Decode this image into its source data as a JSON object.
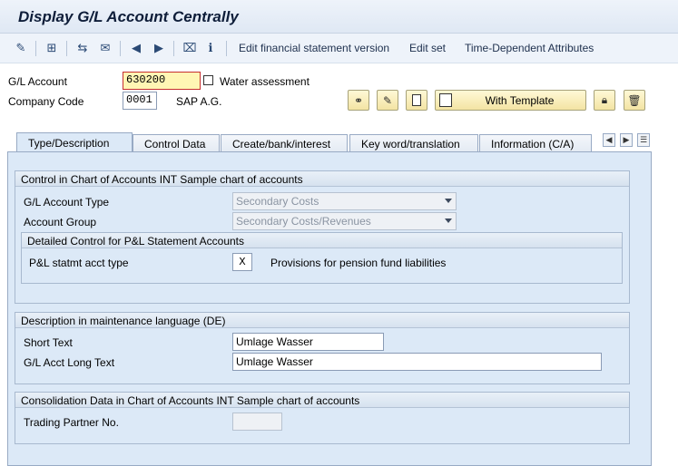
{
  "window": {
    "title": "Display G/L Account Centrally"
  },
  "toolbar": {
    "icons": [
      "change-mode-icon",
      "hierarchy-icon",
      "other-account-icon",
      "mail-icon",
      "previous-icon",
      "next-icon",
      "delete-filter-icon",
      "info-icon"
    ],
    "links": [
      {
        "label": "Edit financial statement version"
      },
      {
        "label": "Edit set"
      },
      {
        "label": "Time-Dependent Attributes"
      }
    ]
  },
  "header": {
    "gl_account_label": "G/L Account",
    "gl_account_value": "630200",
    "gl_account_desc": "Water assessment",
    "company_code_label": "Company Code",
    "company_code_value": "0001",
    "company_name": "SAP A.G.",
    "with_template_label": "With Template"
  },
  "tabs": [
    {
      "label": "Type/Description",
      "active": true
    },
    {
      "label": "Control Data",
      "active": false
    },
    {
      "label": "Create/bank/interest",
      "active": false
    },
    {
      "label": "Key word/translation",
      "active": false
    },
    {
      "label": "Information (C/A)",
      "active": false
    }
  ],
  "control_group": {
    "title": "Control in Chart of Accounts INT Sample chart of accounts",
    "account_type_label": "G/L Account Type",
    "account_type_value": "Secondary Costs",
    "account_group_label": "Account Group",
    "account_group_value": "Secondary Costs/Revenues",
    "pl_group": {
      "title": "Detailed Control for P&L Statement Accounts",
      "pl_type_label": "P&L statmt acct type",
      "pl_type_value": "X",
      "pl_type_desc": "Provisions for pension fund liabilities"
    }
  },
  "description_group": {
    "title": "Description in maintenance language (DE)",
    "short_text_label": "Short Text",
    "short_text_value": "Umlage Wasser",
    "long_text_label": "G/L Acct Long Text",
    "long_text_value": "Umlage Wasser"
  },
  "consolidation_group": {
    "title": "Consolidation Data in Chart of Accounts INT Sample chart of accounts",
    "trading_partner_label": "Trading Partner No.",
    "trading_partner_value": ""
  }
}
